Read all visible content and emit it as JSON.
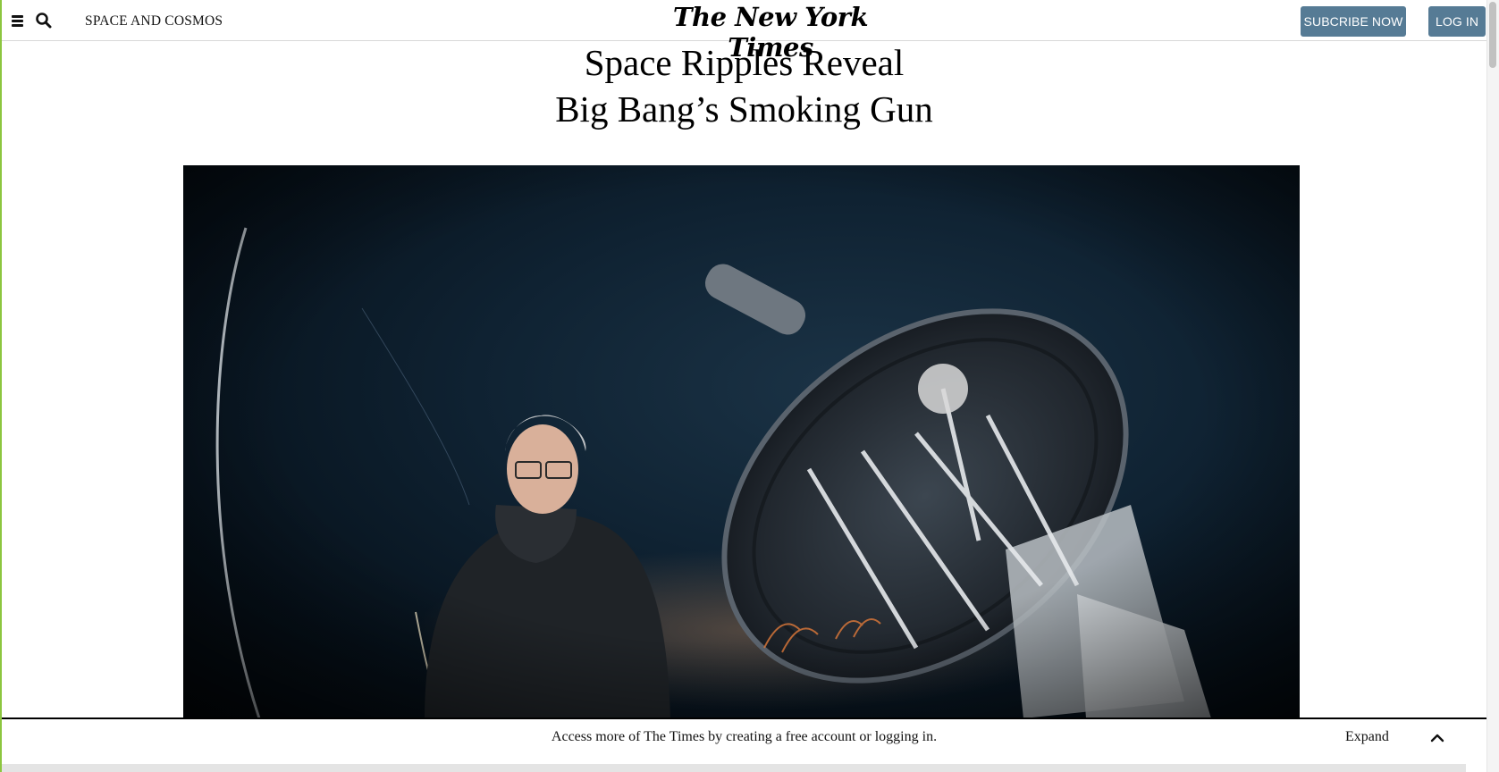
{
  "header": {
    "section": "SPACE AND COSMOS",
    "masthead": "The New York Times",
    "subscribe_label": "SUBCRIBE NOW",
    "login_label": "LOG IN",
    "menu_icon": "hamburger-menu-icon",
    "search_icon": "search-icon"
  },
  "article": {
    "headline_line1": "Space Ripples Reveal",
    "headline_line2": "Big Bang’s Smoking Gun",
    "photo_description_icon": "lead-photo"
  },
  "access_bar": {
    "message": "Access more of The Times by creating a free account or logging in.",
    "expand_label": "Expand",
    "chevron_icon": "chevron-up-icon"
  },
  "colors": {
    "button_bg": "#567b95",
    "frame_accent": "#8cc63f",
    "text": "#121212"
  }
}
